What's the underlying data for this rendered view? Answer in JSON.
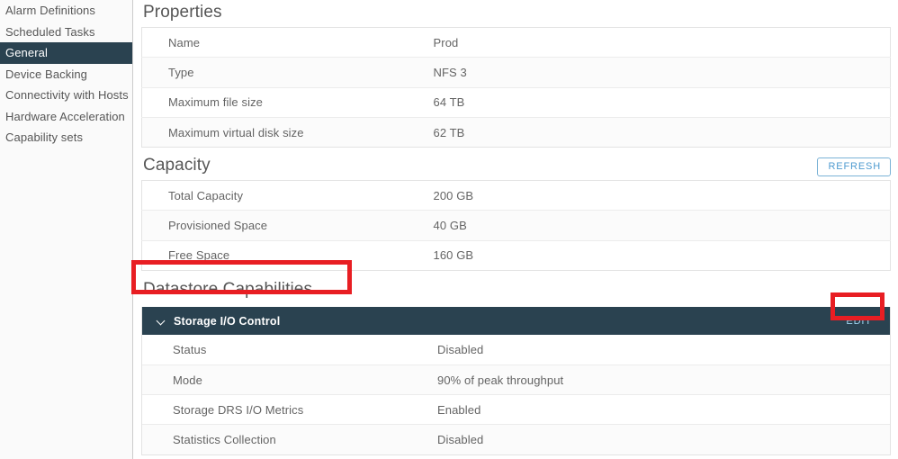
{
  "sidebar": {
    "items": [
      {
        "label": "Alarm Definitions",
        "active": false
      },
      {
        "label": "Scheduled Tasks",
        "active": false
      },
      {
        "label": "General",
        "active": true
      },
      {
        "label": "Device Backing",
        "active": false
      },
      {
        "label": "Connectivity with Hosts",
        "active": false
      },
      {
        "label": "Hardware Acceleration",
        "active": false
      },
      {
        "label": "Capability sets",
        "active": false
      }
    ]
  },
  "properties": {
    "title": "Properties",
    "rows": [
      {
        "key": "Name",
        "value": "Prod"
      },
      {
        "key": "Type",
        "value": "NFS 3"
      },
      {
        "key": "Maximum file size",
        "value": "64 TB"
      },
      {
        "key": "Maximum virtual disk size",
        "value": "62 TB"
      }
    ]
  },
  "capacity": {
    "title": "Capacity",
    "refresh_label": "REFRESH",
    "rows": [
      {
        "key": "Total Capacity",
        "value": "200 GB"
      },
      {
        "key": "Provisioned Space",
        "value": "40 GB"
      },
      {
        "key": "Free Space",
        "value": "160 GB"
      }
    ]
  },
  "datastore_capabilities": {
    "title": "Datastore Capabilities",
    "sioc": {
      "header": "Storage I/O Control",
      "edit_label": "EDIT",
      "expanded": true,
      "rows": [
        {
          "key": "Status",
          "value": "Disabled"
        },
        {
          "key": "Mode",
          "value": "90% of peak throughput"
        },
        {
          "key": "Storage DRS I/O Metrics",
          "value": "Enabled"
        },
        {
          "key": "Statistics Collection",
          "value": "Disabled"
        }
      ]
    }
  },
  "annotations": {
    "highlight_color": "#e81e23",
    "boxes": [
      {
        "name": "datastore-capabilities-highlight"
      },
      {
        "name": "edit-button-highlight"
      }
    ]
  },
  "colors": {
    "sidebar_active_bg": "#2a4250",
    "sioc_header_bg": "#2a4250",
    "link_blue": "#4f9bd0",
    "edit_blue": "#9ed4f0",
    "text": "#565656"
  }
}
